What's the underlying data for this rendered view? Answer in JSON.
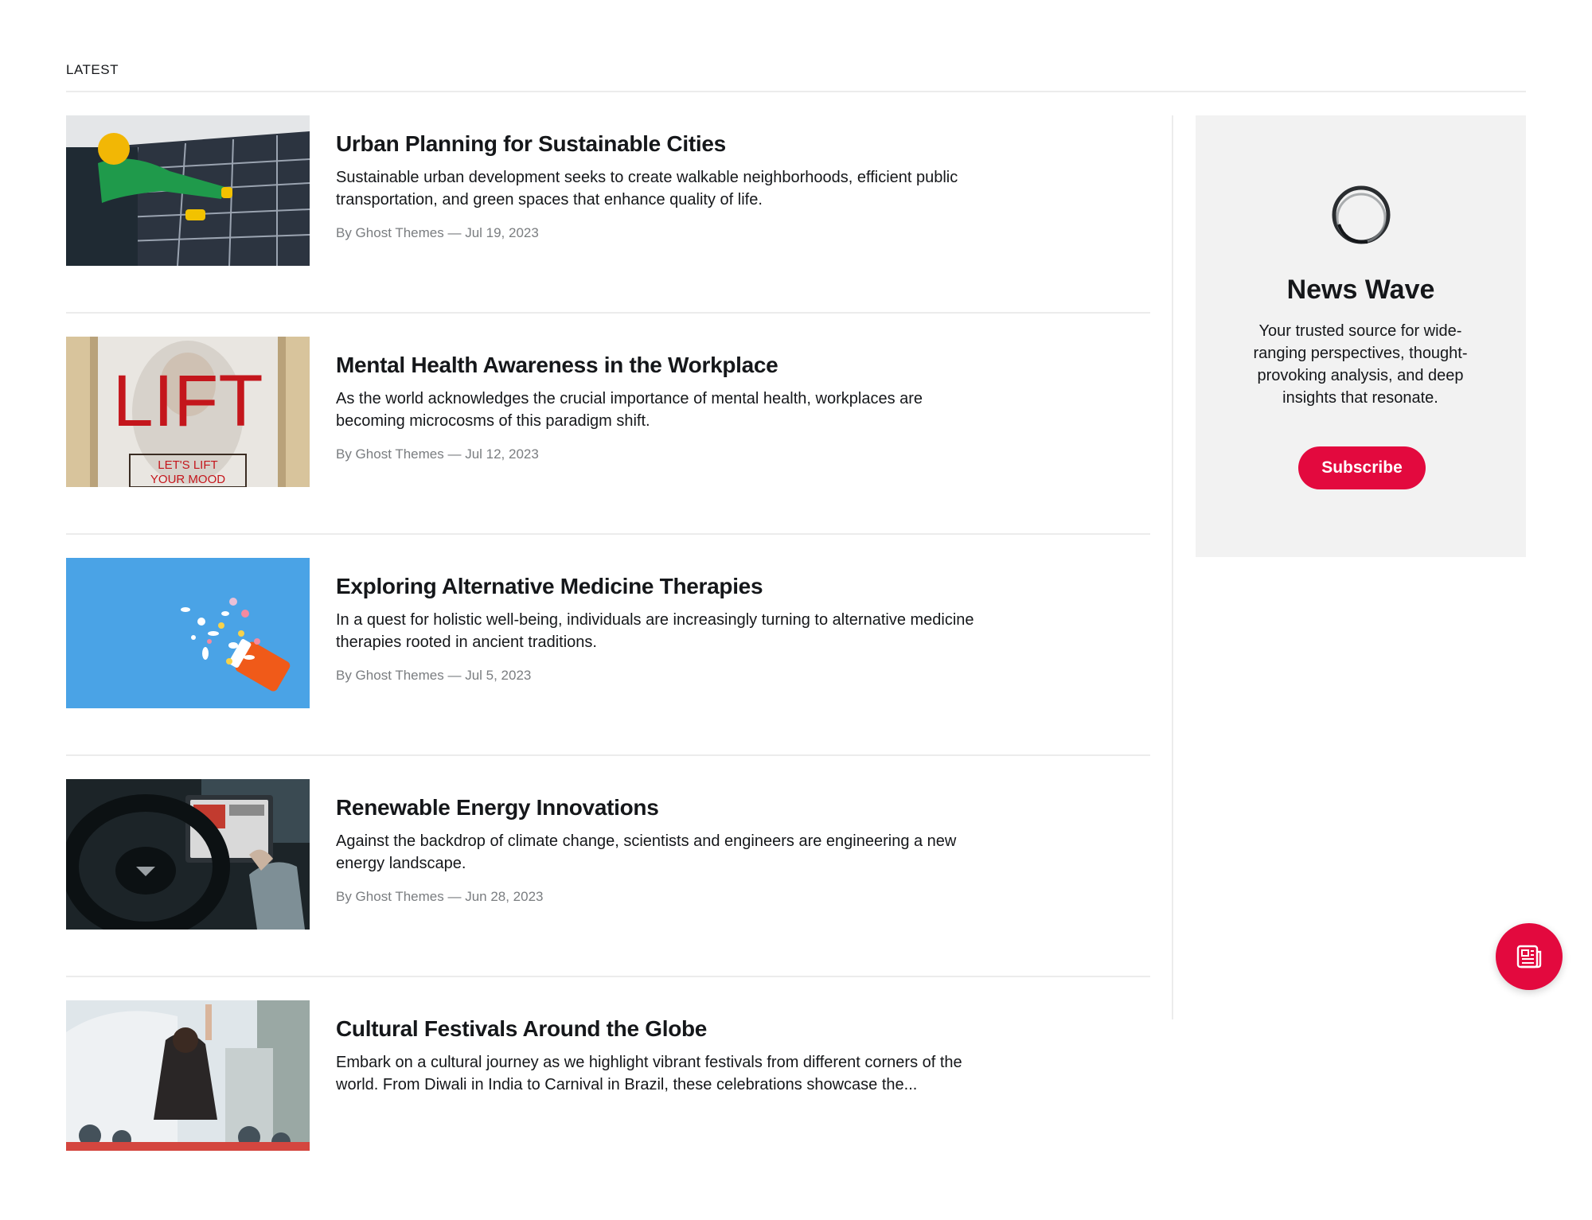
{
  "section": {
    "label": "LATEST"
  },
  "posts": [
    {
      "title": "Urban Planning for Sustainable Cities",
      "excerpt": "Sustainable urban development seeks to create walkable neighborhoods, efficient public transportation, and green spaces that enhance quality of life.",
      "meta": "By Ghost Themes — Jul 19, 2023"
    },
    {
      "title": "Mental Health Awareness in the Workplace",
      "excerpt": "As the world acknowledges the crucial importance of mental health, workplaces are becoming microcosms of this paradigm shift.",
      "meta": "By Ghost Themes — Jul 12, 2023",
      "image_text": {
        "big": "LIFT",
        "line1": "LET'S LIFT",
        "line2": "YOUR MOOD"
      }
    },
    {
      "title": "Exploring Alternative Medicine Therapies",
      "excerpt": "In a quest for holistic well-being, individuals are increasingly turning to alternative medicine therapies rooted in ancient traditions.",
      "meta": "By Ghost Themes — Jul 5, 2023"
    },
    {
      "title": "Renewable Energy Innovations",
      "excerpt": "Against the backdrop of climate change, scientists and engineers are engineering a new energy landscape.",
      "meta": "By Ghost Themes — Jun 28, 2023"
    },
    {
      "title": "Cultural Festivals Around the Globe",
      "excerpt": "Embark on a cultural journey as we highlight vibrant festivals from different corners of the world. From Diwali in India to Carnival in Brazil, these celebrations showcase the...",
      "meta": ""
    }
  ],
  "sidebar": {
    "brand_name": "News Wave",
    "description": "Your trusted source for wide-ranging perspectives, thought-provoking analysis, and deep insights that resonate.",
    "subscribe_label": "Subscribe"
  },
  "icons": {
    "logo": "ring-logo-icon",
    "fab": "newspaper-icon"
  },
  "colors": {
    "accent": "#e3093e",
    "meta_text": "#7a7d80",
    "card_bg": "#f2f2f2"
  }
}
